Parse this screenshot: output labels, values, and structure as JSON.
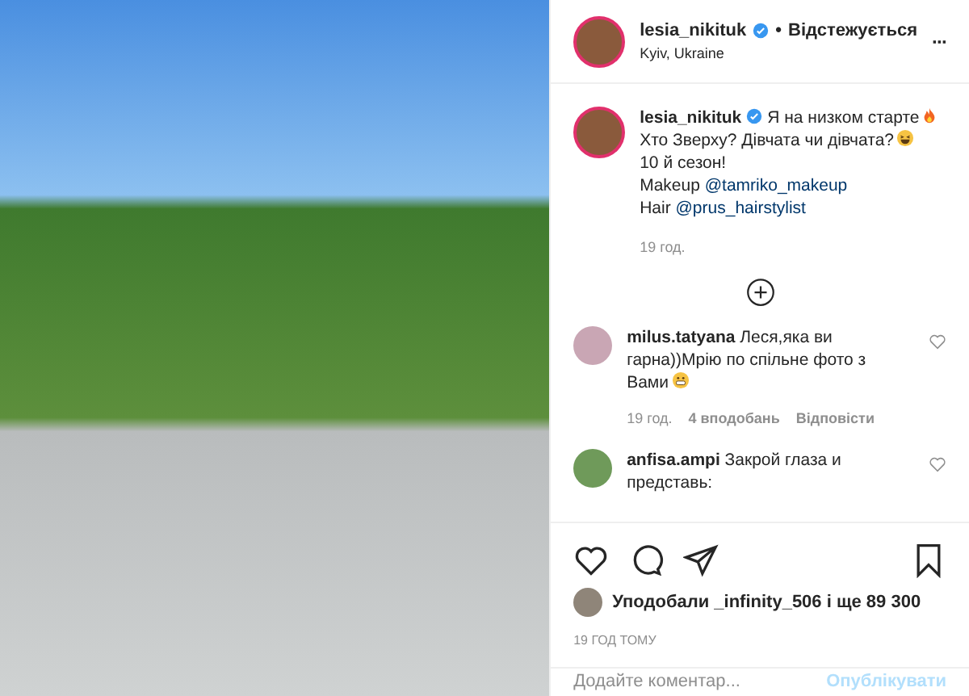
{
  "post_header": {
    "username": "lesia_nikituk",
    "verified": true,
    "separator": "•",
    "follow_status": "Відстежується",
    "location": "Kyiv, Ukraine",
    "more": "···"
  },
  "caption": {
    "username": "lesia_nikituk",
    "verified": true,
    "lines": [
      {
        "kind": "fire",
        "text": "Я на низком старте"
      },
      {
        "kind": "laughing",
        "text": "Хто Зверху? Дівчата чи дівчата?"
      },
      {
        "kind": "plain",
        "text": "10 й сезон!"
      },
      {
        "kind": "plain",
        "text": "Makeup",
        "mention": "@tamriko_makeup"
      },
      {
        "kind": "plain",
        "text": "Hair",
        "mention": "@prus_hairstylist"
      }
    ],
    "time": "19 год."
  },
  "comments": [
    {
      "kind": "grin",
      "text": "**milus.tatyana** Леся,яка ви гарна))Мрію по спільне фото з Вами",
      "time": "19 год.",
      "likes": "4 вподобань",
      "reply": "Відповісти",
      "liked": false
    },
    {
      "kind": "plain",
      "text": "**anfisa.ampi** Закрой глаза и представь:",
      "liked": false
    }
  ],
  "likes": {
    "text": "Уподобали _infinity_506 і ще 89 300"
  },
  "timestamp": "19 ГОД ТОМУ",
  "comment_box": {
    "placeholder": "Додайте коментар...",
    "button": "Опублікувати"
  }
}
